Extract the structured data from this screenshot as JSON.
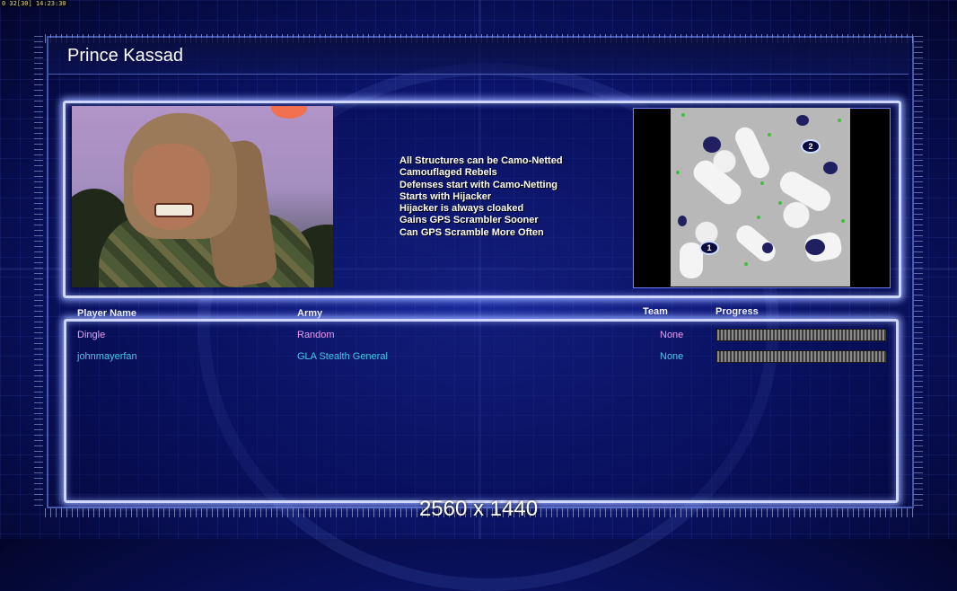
{
  "debug": {
    "stats_text": "0 32[30] 14:23:30"
  },
  "header": {
    "title": "Prince Kassad"
  },
  "general": {
    "traits": [
      "All Structures can be Camo-Netted",
      "Camouflaged Rebels",
      "Defenses start with Camo-Netting",
      "Starts with Hijacker",
      "Hijacker is always cloaked",
      "Gains GPS Scrambler Sooner",
      "Can GPS Scramble More Often"
    ]
  },
  "map": {
    "start_positions": [
      "1",
      "2"
    ]
  },
  "players": {
    "columns": {
      "name": "Player Name",
      "army": "Army",
      "team": "Team",
      "progress": "Progress"
    },
    "rows": [
      {
        "name": "Dingle",
        "army": "Random",
        "team": "None",
        "progress": 0,
        "color": "#e89ef0"
      },
      {
        "name": "johnmayerfan",
        "army": "GLA Stealth General",
        "team": "None",
        "progress": 0,
        "color": "#46c8e8"
      }
    ]
  },
  "overlay": {
    "resolution_text": "2560 x 1440"
  },
  "colors": {
    "panel_glow": "#cfd6ff",
    "background": "#0c1670",
    "player1": "#e89ef0",
    "player2": "#46c8e8"
  }
}
